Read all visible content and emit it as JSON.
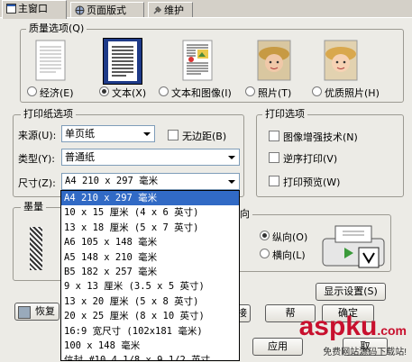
{
  "tabs": [
    {
      "label": "主窗口",
      "active": true
    },
    {
      "label": "页面版式",
      "active": false
    },
    {
      "label": "维护",
      "active": false
    }
  ],
  "quality": {
    "title": "质量选项(Q)",
    "options": [
      {
        "label": "经济(E)",
        "selected": false,
        "icon": "economy-doc-icon"
      },
      {
        "label": "文本(X)",
        "selected": true,
        "icon": "text-doc-icon"
      },
      {
        "label": "文本和图像(I)",
        "selected": false,
        "icon": "text-image-doc-icon"
      },
      {
        "label": "照片(T)",
        "selected": false,
        "icon": "photo-icon"
      },
      {
        "label": "优质照片(H)",
        "selected": false,
        "icon": "best-photo-icon"
      }
    ]
  },
  "paper": {
    "title": "打印纸选项",
    "source_label": "来源(U):",
    "source_value": "单页纸",
    "borderless_label": "无边距(B)",
    "type_label": "类型(Y):",
    "type_value": "普通纸",
    "size_label": "尺寸(Z):",
    "size_value": "A4 210 x 297 毫米"
  },
  "print_options": {
    "title": "打印选项",
    "items": [
      "图像增强技术(N)",
      "逆序打印(V)",
      "打印预览(W)"
    ]
  },
  "ink": {
    "title": "墨量"
  },
  "orientation": {
    "title_fragment": "向",
    "portrait": "纵向(O)",
    "landscape": "横向(L)",
    "portrait_selected": true
  },
  "buttons": {
    "show_settings": "显示设置(S)",
    "restore_fragment": "恢复",
    "row_fragment": "接",
    "help_fragment": "帮",
    "ok": "确定",
    "cancel_fragment": "取",
    "apply_fragment": "应用"
  },
  "size_dropdown": {
    "items": [
      "A4 210 x 297 毫米",
      "10 x 15 厘米 (4 x 6 英寸)",
      "13 x 18 厘米 (5 x 7 英寸)",
      "A6 105 x 148 毫米",
      "A5 148 x 210 毫米",
      "B5 182 x 257 毫米",
      "9 x 13 厘米 (3.5 x 5 英寸)",
      "13 x 20 厘米 (5 x 8 英寸)",
      "20 x 25 厘米 (8 x 10 英寸)",
      "16:9 宽尺寸 (102x181 毫米)",
      "100 x 148 毫米",
      "信封 #10 4 1/8 x 9 1/2 英寸"
    ],
    "selected_index": 0
  },
  "watermark": {
    "brand": "aspku",
    "tld": ".com",
    "subtitle": "免费网站源码下载站!"
  }
}
